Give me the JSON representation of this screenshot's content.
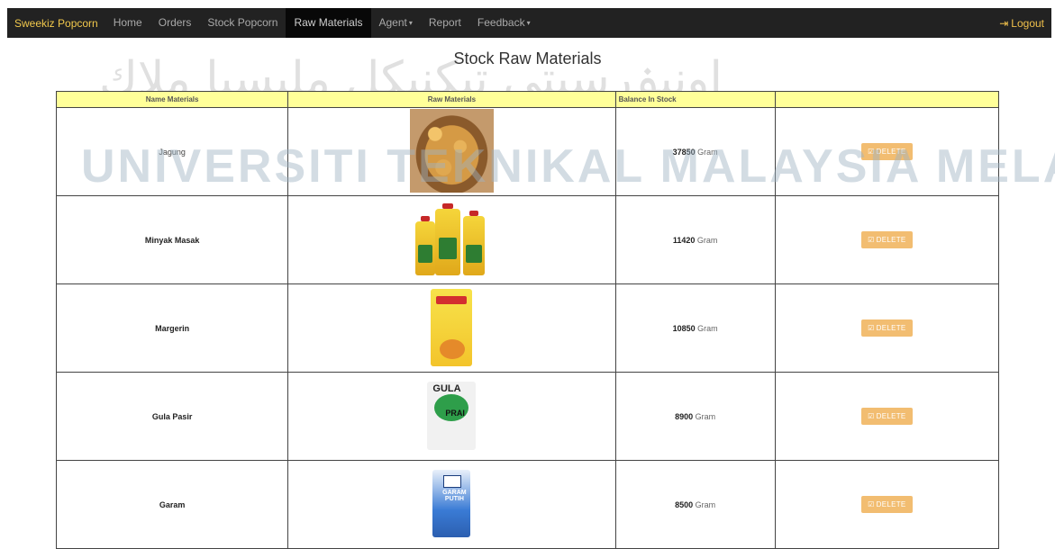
{
  "navbar": {
    "brand": "Sweekiz Popcorn",
    "items": [
      {
        "label": "Home"
      },
      {
        "label": "Orders"
      },
      {
        "label": "Stock Popcorn"
      },
      {
        "label": "Raw Materials"
      },
      {
        "label": "Agent",
        "dropdown": true
      },
      {
        "label": "Report"
      },
      {
        "label": "Feedback",
        "dropdown": true
      }
    ],
    "logout": "Logout",
    "active_index": 3
  },
  "page_title": "Stock Raw Materials",
  "watermark": {
    "text": "UNIVERSITI TEKNIKAL MALAYSIA MELAKA",
    "arabic_left": "اونيۏرسيتي تيكنيكل مليسيا ملاك",
    "arabic_right": ""
  },
  "table": {
    "headers": [
      "Name Materials",
      "Raw Materials",
      "Balance In Stock",
      ""
    ],
    "rows": [
      {
        "name": "Jagung",
        "image": "corn-kernels",
        "balance": "37850",
        "unit": "Gram",
        "action": "DELETE"
      },
      {
        "name": "Minyak Masak",
        "image": "cooking-oil-bottles",
        "balance": "11420",
        "unit": "Gram",
        "action": "DELETE"
      },
      {
        "name": "Margerin",
        "image": "margarine-pack",
        "balance": "10850",
        "unit": "Gram",
        "action": "DELETE"
      },
      {
        "name": "Gula Pasir",
        "image": "sugar-pack",
        "balance": "8900",
        "unit": "Gram",
        "action": "DELETE"
      },
      {
        "name": "Garam",
        "image": "salt-pack",
        "balance": "8500",
        "unit": "Gram",
        "action": "DELETE"
      }
    ]
  },
  "image_labels": {
    "gula_top": "GULA",
    "gula_bottom": "PRAI",
    "garam": "GARAM PUTIH"
  },
  "colors": {
    "navbar_bg": "#222222",
    "brand": "#f2c94c",
    "header_bg": "#ffff99",
    "delete_button": "#f0ad4e"
  }
}
